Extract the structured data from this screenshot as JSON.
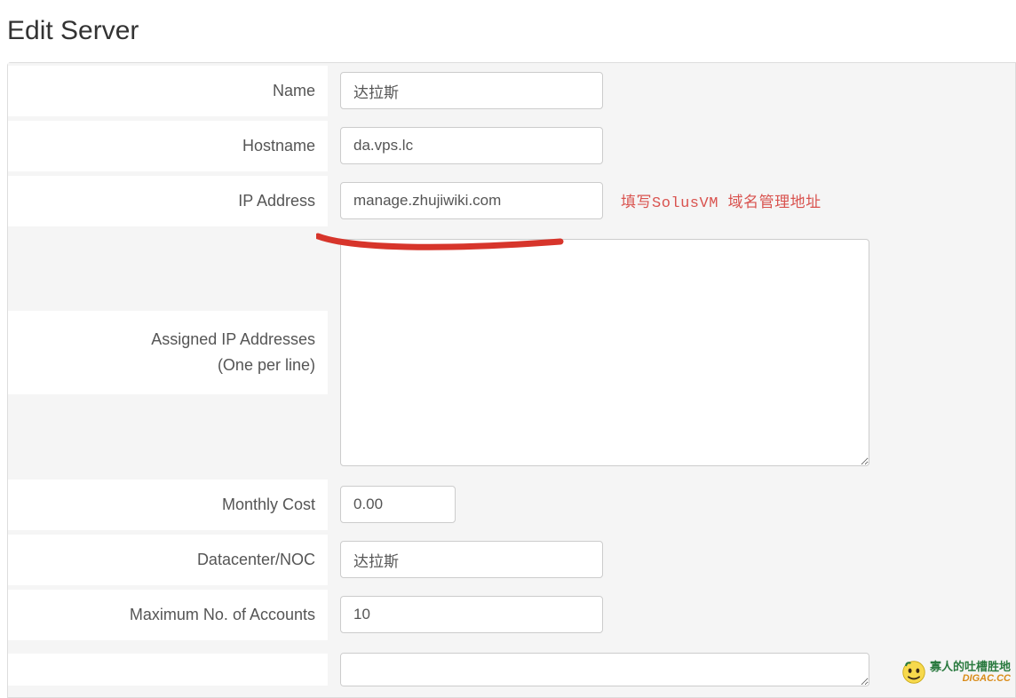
{
  "page": {
    "title": "Edit Server"
  },
  "form": {
    "name": {
      "label": "Name",
      "value": "达拉斯"
    },
    "hostname": {
      "label": "Hostname",
      "value": "da.vps.lc"
    },
    "ip_address": {
      "label": "IP Address",
      "value": "manage.zhujiwiki.com",
      "hint": "填写SolusVM 域名管理地址"
    },
    "assigned_ips": {
      "label_line1": "Assigned IP Addresses",
      "label_line2": "(One per line)",
      "value": ""
    },
    "monthly_cost": {
      "label": "Monthly Cost",
      "value": "0.00"
    },
    "datacenter": {
      "label": "Datacenter/NOC",
      "value": "达拉斯"
    },
    "max_accounts": {
      "label": "Maximum No. of Accounts",
      "value": "10"
    }
  },
  "watermark": {
    "line1": "寡人的吐槽胜地",
    "line2": "DIGAC.CC"
  }
}
